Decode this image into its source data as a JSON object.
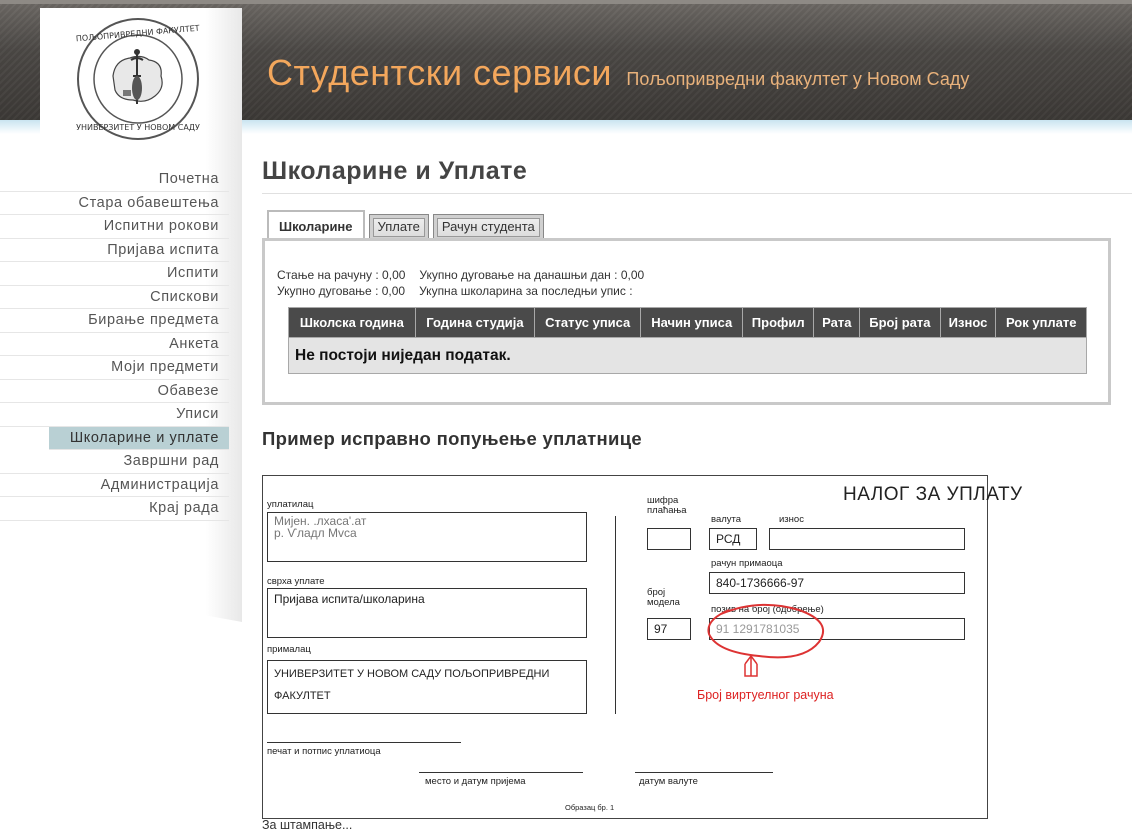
{
  "header": {
    "title": "Студентски сервиси",
    "subtitle": "Пољопривредни факултет у Новом Саду"
  },
  "sidebar": {
    "items": [
      {
        "label": "Почетна"
      },
      {
        "label": "Стара обавештења"
      },
      {
        "label": "Испитни рокови"
      },
      {
        "label": "Пријава испита"
      },
      {
        "label": "Испити"
      },
      {
        "label": "Спискови"
      },
      {
        "label": "Бирање предмета"
      },
      {
        "label": "Анкета"
      },
      {
        "label": "Моји предмети"
      },
      {
        "label": "Обавезе"
      },
      {
        "label": "Уписи"
      },
      {
        "label": "Школарине и уплате",
        "active": true
      },
      {
        "label": "Завршни рад"
      },
      {
        "label": "Администрација"
      },
      {
        "label": "Крај рада"
      }
    ]
  },
  "main": {
    "title": "Школарине и Уплате",
    "tabs": [
      {
        "label": "Школарине",
        "active": true
      },
      {
        "label": "Уплате"
      },
      {
        "label": "Рачун студента"
      }
    ],
    "info": {
      "balance": "Стање на рачуну : 0,00",
      "debt_today": "Укупно дуговање на данашњи дан : 0,00",
      "total_debt": "Укупно дуговање : 0,00",
      "tuition_last": "Укупна школарина за последњи упис :"
    },
    "table": {
      "columns": [
        "Школска година",
        "Година студија",
        "Статус уписа",
        "Начин уписа",
        "Профил",
        "Рата",
        "Број рата",
        "Износ",
        "Рок уплате"
      ],
      "empty_message": "Не постоји ниједан податак."
    },
    "example_title": "Пример исправно попуњење уплатнице",
    "print_link": "За штампање..."
  },
  "slip": {
    "title": "НАЛОГ ЗА УПЛАТУ",
    "payer_label": "уплатилац",
    "payer_line1": "Мијен. .лхаса'.ат",
    "payer_line2": "р. Ѵладл Мvса",
    "purpose_label": "сврха уплате",
    "purpose_value": "Пријава испита/школарина",
    "recipient_label": "прималац",
    "recipient_line1": "УНИВЕРЗИТЕТ У НОВОМ САДУ ПОЉОПРИВРЕДНИ",
    "recipient_line2": "ФАКУЛТЕТ",
    "signature_label": "печат и потпис уплатиоца",
    "place_date_label": "место и датум пријема",
    "value_date_label": "датум валуте",
    "form_number": "Образац бр. 1",
    "payment_code_label_1": "шифра",
    "payment_code_label_2": "плаћања",
    "currency_label": "валута",
    "currency_value": "РСД",
    "amount_label": "износ",
    "account_label": "рачун примаоца",
    "account_value": "840-1736666-97",
    "model_label_1": "број",
    "model_label_2": "модела",
    "model_value": "97",
    "reference_label": "позив на број (одобрење)",
    "reference_value": "91 1291781035",
    "annotation": "Број виртуелног рачуна"
  }
}
